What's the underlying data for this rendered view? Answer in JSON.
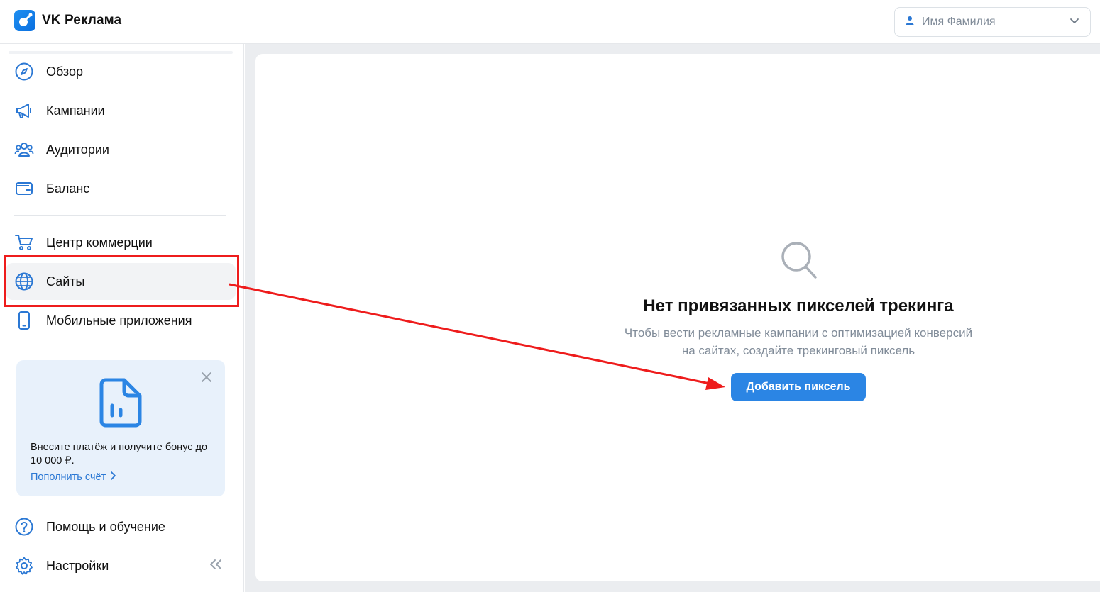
{
  "header": {
    "logo_text": "VK Реклама",
    "user_name": "Имя Фамилия"
  },
  "sidebar": {
    "items": [
      {
        "label": "Обзор",
        "icon": "compass-icon"
      },
      {
        "label": "Кампании",
        "icon": "megaphone-icon"
      },
      {
        "label": "Аудитории",
        "icon": "users-icon"
      },
      {
        "label": "Баланс",
        "icon": "wallet-icon"
      },
      {
        "label": "Центр коммерции",
        "icon": "cart-icon"
      },
      {
        "label": "Сайты",
        "icon": "globe-icon",
        "active": true
      },
      {
        "label": "Мобильные приложения",
        "icon": "phone-icon"
      }
    ],
    "bottom_items": [
      {
        "label": "Помощь и обучение",
        "icon": "help-circle-icon"
      },
      {
        "label": "Настройки",
        "icon": "gear-icon"
      }
    ],
    "promo": {
      "text": "Внесите платёж и получите бонус до 10 000 ₽.",
      "link": "Пополнить счёт"
    }
  },
  "main": {
    "empty_title": "Нет привязанных пикселей трекинга",
    "empty_desc_line1": "Чтобы вести рекламные кампании с оптимизацией конверсий",
    "empty_desc_line2": "на сайтах, создайте трекинговый пиксель",
    "add_button": "Добавить пиксель"
  },
  "colors": {
    "accent": "#2b85e4",
    "icon_blue": "#2b78d4",
    "annotation_red": "#ee1c1c"
  }
}
